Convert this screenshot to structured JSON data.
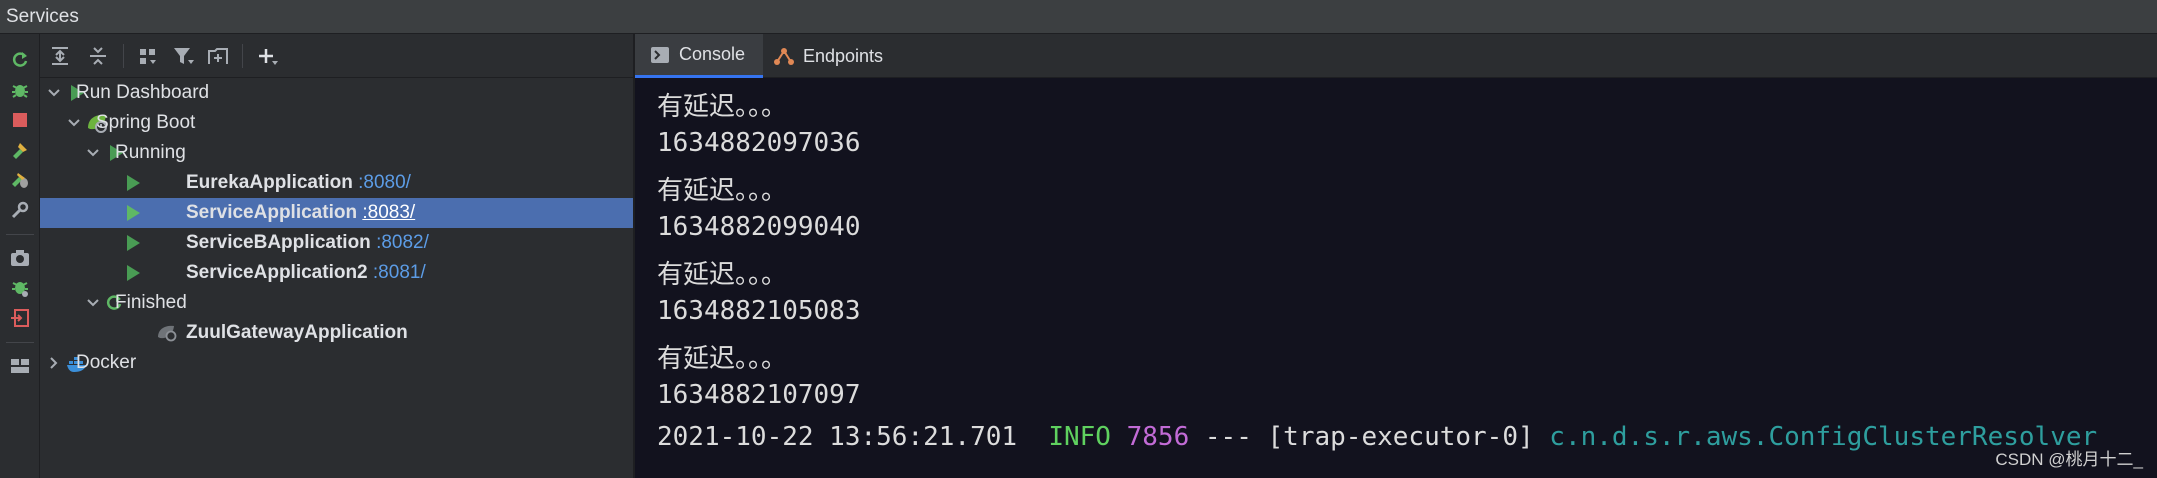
{
  "window": {
    "title": "Services"
  },
  "tree": {
    "items": [
      {
        "label": "Run Dashboard"
      },
      {
        "label": "Spring Boot"
      },
      {
        "label": "Running"
      },
      {
        "label": "EurekaApplication",
        "port": ":8080/"
      },
      {
        "label": "ServiceApplication",
        "port": ":8083/"
      },
      {
        "label": "ServiceBApplication",
        "port": ":8082/"
      },
      {
        "label": "ServiceApplication2",
        "port": ":8081/"
      },
      {
        "label": "Finished"
      },
      {
        "label": "ZuulGatewayApplication"
      },
      {
        "label": "Docker"
      }
    ],
    "selected_item": "ServiceApplication"
  },
  "tabs": [
    {
      "label": "Console",
      "icon": "console-icon",
      "active": true
    },
    {
      "label": "Endpoints",
      "icon": "endpoints-icon",
      "active": false
    }
  ],
  "console": {
    "lines": [
      "有延迟。。。",
      "1634882097036",
      "有延迟。。。",
      "1634882099040",
      "有延迟。。。",
      "1634882105083",
      "有延迟。。。",
      "1634882107097"
    ],
    "log": {
      "timestamp": "2021-10-22 13:56:21.701",
      "level": "INFO",
      "pid": "7856",
      "sep": "---",
      "thread": "[trap-executor-0]",
      "logger": "c.n.d.s.r.aws.ConfigClusterResolver"
    }
  },
  "watermark": "CSDN @桃月十二_",
  "colors": {
    "selection": "#4b6eaf",
    "run_green": "#499c54",
    "console_bg": "#12121e",
    "info": "#5fd15f",
    "pid": "#c26bd6",
    "logger": "#2e9e9e",
    "port_link": "#5c9ce6"
  }
}
